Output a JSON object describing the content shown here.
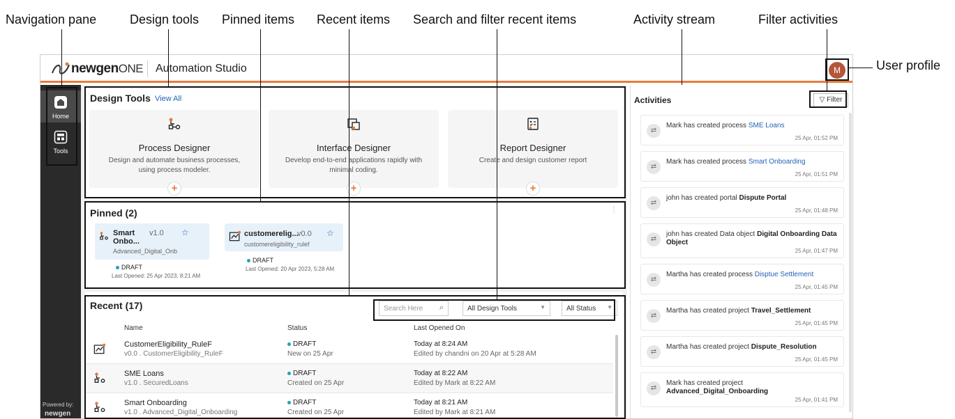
{
  "callouts": {
    "navigation_pane": "Navigation pane",
    "design_tools": "Design tools",
    "pinned_items": "Pinned items",
    "recent_items": "Recent items",
    "search_filter": "Search and filter recent items",
    "activity_stream": "Activity stream",
    "filter_activities": "Filter activities",
    "user_profile": "User profile"
  },
  "header": {
    "brand_main": "newgen",
    "brand_suffix": "ONE",
    "app_title": "Automation Studio",
    "avatar_initial": "M"
  },
  "nav": {
    "items": [
      {
        "label": "Home"
      },
      {
        "label": "Tools"
      }
    ],
    "powered_by": "Powered by:",
    "powered_logo": "newgen"
  },
  "design_tools": {
    "title": "Design Tools",
    "view_all": "View All",
    "tools": [
      {
        "name": "Process Designer",
        "desc": "Design and automate business processes, using process modeler.",
        "icon": "process-icon"
      },
      {
        "name": "Interface Designer",
        "desc": "Develop end-to-end applications rapidly with minimal coding.",
        "icon": "interface-icon"
      },
      {
        "name": "Report Designer",
        "desc": "Create and design customer report",
        "icon": "report-icon"
      }
    ],
    "plus": "+"
  },
  "pinned": {
    "title": "Pinned (2)",
    "items": [
      {
        "name": "Smart Onbo...",
        "version": "v1.0",
        "sub": "Advanced_Digital_Onb",
        "status": "DRAFT",
        "last_opened": "Last Opened: 25 Apr 2023, 8:21 AM"
      },
      {
        "name": "customerelig...",
        "version": "v0.0",
        "sub": "customereligibility_rulef",
        "status": "DRAFT",
        "last_opened": "Last Opened: 20 Apr 2023, 5:28 AM"
      }
    ]
  },
  "recent": {
    "title": "Recent (17)",
    "search_placeholder": "Search Here",
    "filter_tools": "All Design Tools",
    "filter_status": "All Status",
    "columns": {
      "name": "Name",
      "status": "Status",
      "last_opened": "Last Opened On"
    },
    "rows": [
      {
        "name": "CustomerEligibility_RuleF",
        "sub": "v0.0 . CustomerEligibility_RuleF",
        "status": "DRAFT",
        "created": "New on 25 Apr",
        "opened": "Today at 8:24 AM",
        "edited": "Edited by chandni on 20 Apr at 5:28 AM",
        "icon": "chart-icon"
      },
      {
        "name": "SME Loans",
        "sub": "v1.0 . SecuredLoans",
        "status": "DRAFT",
        "created": "Created on 25 Apr",
        "opened": "Today at 8:22 AM",
        "edited": "Edited by Mark at 8:22 AM",
        "icon": "process-icon"
      },
      {
        "name": "Smart Onboarding",
        "sub": "v1.0 . Advanced_Digital_Onboarding",
        "status": "DRAFT",
        "created": "Created on 25 Apr",
        "opened": "Today at 8:21 AM",
        "edited": "Edited by Mark at 8:21 AM",
        "icon": "process-icon"
      }
    ]
  },
  "activities": {
    "title": "Activities",
    "filter_label": "Filter",
    "items": [
      {
        "prefix": "Mark has created process ",
        "target": "SME Loans",
        "style": "blue",
        "time": "25 Apr, 01:52 PM"
      },
      {
        "prefix": "Mark has created process ",
        "target": "Smart Onboarding",
        "style": "blue",
        "time": "25 Apr, 01:51 PM"
      },
      {
        "prefix": "john has created portal ",
        "target": "Dispute Portal",
        "style": "bold",
        "time": "25 Apr, 01:48 PM"
      },
      {
        "prefix": "john has created Data object ",
        "target": "Digital Onboarding Data Object",
        "style": "bold",
        "time": "25 Apr, 01:47 PM"
      },
      {
        "prefix": "Martha has created process ",
        "target": "Disptue Settlement",
        "style": "blue",
        "time": "25 Apr, 01:45 PM"
      },
      {
        "prefix": "Martha has created project ",
        "target": "Travel_Settlement",
        "style": "bold",
        "time": "25 Apr, 01:45 PM"
      },
      {
        "prefix": "Martha has created project ",
        "target": "Dispute_Resolution",
        "style": "bold",
        "time": "25 Apr, 01:45 PM"
      },
      {
        "prefix": "Mark has created project ",
        "target": "Advanced_Digital_Onboarding",
        "style": "bold",
        "time": "25 Apr, 01:41 PM"
      }
    ]
  },
  "colors": {
    "accent": "#e97a3c",
    "link": "#2463b5",
    "nav_bg": "#2a2a2a",
    "status_dot": "#22a2b5"
  }
}
